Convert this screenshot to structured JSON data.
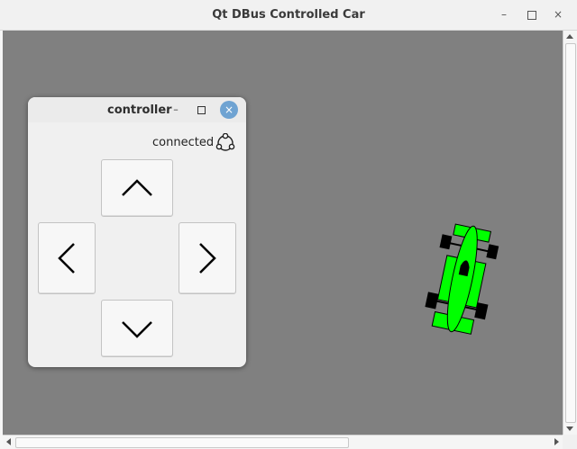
{
  "window": {
    "title": "Qt DBus Controlled Car",
    "controls": {
      "minimize": "–",
      "maximize": "□",
      "close": "×"
    }
  },
  "controller": {
    "title": "controller",
    "status_text": "connected",
    "status_icon": "connection-icon",
    "buttons": [
      {
        "name": "up",
        "icon": "chevron-up-icon"
      },
      {
        "name": "left",
        "icon": "chevron-left-icon"
      },
      {
        "name": "right",
        "icon": "chevron-right-icon"
      },
      {
        "name": "down",
        "icon": "chevron-down-icon"
      }
    ]
  },
  "scene": {
    "background_color": "#808080",
    "car_color": "#00ff00",
    "wheel_color": "#000000"
  },
  "controls_icons": {
    "close_button_color": "#6fa3d2"
  }
}
